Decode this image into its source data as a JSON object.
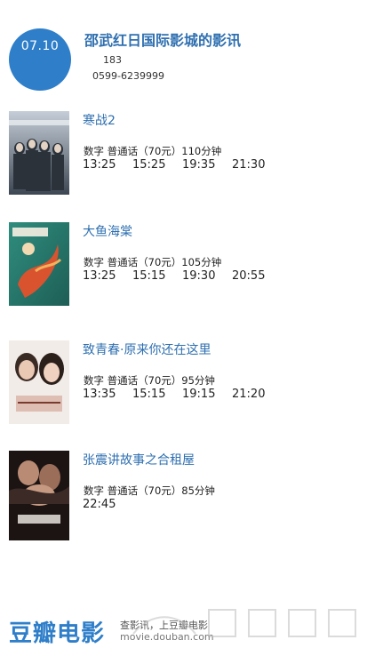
{
  "header": {
    "date": "07.10",
    "cinema_name": "邵武红日国际影城的影讯",
    "address": "183",
    "phone": "0599-6239999"
  },
  "movies": [
    {
      "title": "寒战2",
      "meta": "数字  普通话（70元）110分钟",
      "times": [
        "13:25",
        "15:25",
        "19:35",
        "21:30"
      ],
      "poster_colors": [
        "#9aa6b3",
        "#3d4753"
      ]
    },
    {
      "title": "大鱼海棠",
      "meta": "数字  普通话（70元）105分钟",
      "times": [
        "13:25",
        "15:15",
        "19:30",
        "20:55"
      ],
      "poster_colors": [
        "#2f8d7e",
        "#c84a2e"
      ]
    },
    {
      "title": "致青春·原来你还在这里",
      "meta": "数字  普通话（70元）95分钟",
      "times": [
        "13:35",
        "15:15",
        "19:15",
        "21:20"
      ],
      "poster_colors": [
        "#f0e6e2",
        "#b96a56"
      ]
    },
    {
      "title": "张震讲故事之合租屋",
      "meta": "数字  普通话（70元）85分钟",
      "times": [
        "22:45"
      ],
      "poster_colors": [
        "#5a4038",
        "#1b1412"
      ]
    }
  ],
  "footer": {
    "brand": "豆瓣电影",
    "tagline": "查影讯，上豆瓣电影",
    "site": "movie.douban.com"
  },
  "colors": {
    "accent": "#2e7ec9",
    "title_blue": "#2e6fb0"
  }
}
